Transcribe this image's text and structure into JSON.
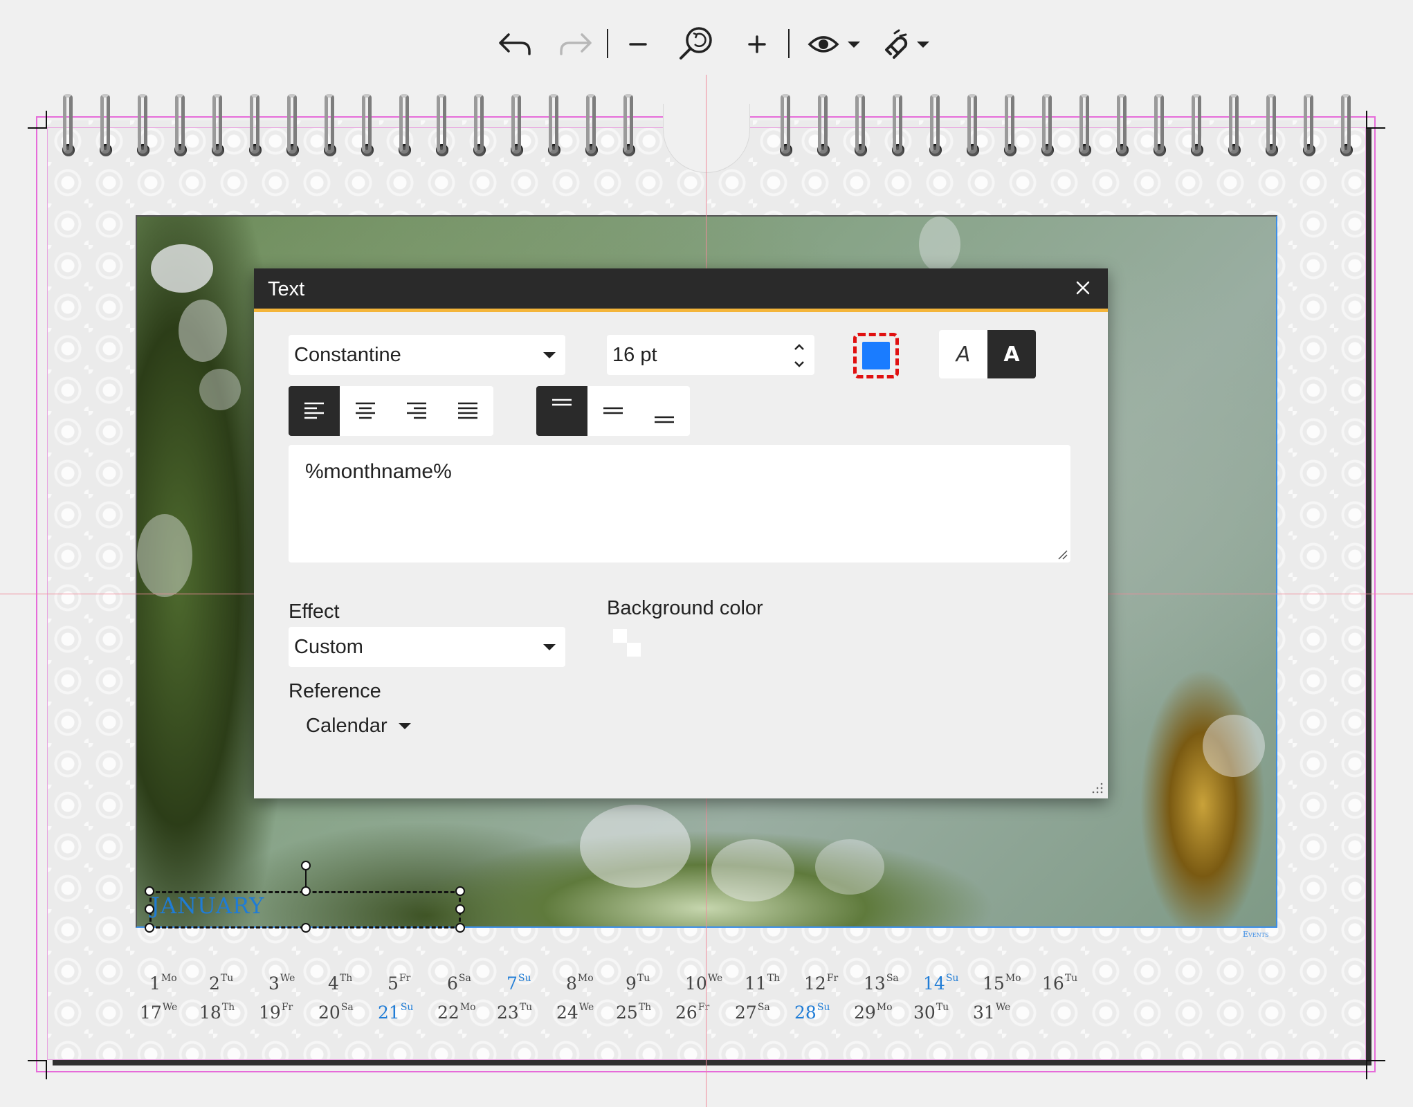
{
  "toolbar": {
    "undo": "undo-icon",
    "redo": "redo-icon",
    "zoom_out": "minus-icon",
    "zoom_fit": "zoom-icon",
    "zoom_in": "plus-icon",
    "preview": "eye-icon",
    "snap": "magnet-icon"
  },
  "calendar": {
    "month_label": "JANUARY",
    "events_label": "Events",
    "days": [
      {
        "n": "1",
        "d": "Mo",
        "sun": false
      },
      {
        "n": "2",
        "d": "Tu",
        "sun": false
      },
      {
        "n": "3",
        "d": "We",
        "sun": false
      },
      {
        "n": "4",
        "d": "Th",
        "sun": false
      },
      {
        "n": "5",
        "d": "Fr",
        "sun": false
      },
      {
        "n": "6",
        "d": "Sa",
        "sun": false
      },
      {
        "n": "7",
        "d": "Su",
        "sun": true
      },
      {
        "n": "8",
        "d": "Mo",
        "sun": false
      },
      {
        "n": "9",
        "d": "Tu",
        "sun": false
      },
      {
        "n": "10",
        "d": "We",
        "sun": false
      },
      {
        "n": "11",
        "d": "Th",
        "sun": false
      },
      {
        "n": "12",
        "d": "Fr",
        "sun": false
      },
      {
        "n": "13",
        "d": "Sa",
        "sun": false
      },
      {
        "n": "14",
        "d": "Su",
        "sun": true
      },
      {
        "n": "15",
        "d": "Mo",
        "sun": false
      },
      {
        "n": "16",
        "d": "Tu",
        "sun": false
      },
      {
        "n": "17",
        "d": "We",
        "sun": false
      },
      {
        "n": "18",
        "d": "Th",
        "sun": false
      },
      {
        "n": "19",
        "d": "Fr",
        "sun": false
      },
      {
        "n": "20",
        "d": "Sa",
        "sun": false
      },
      {
        "n": "21",
        "d": "Su",
        "sun": true
      },
      {
        "n": "22",
        "d": "Mo",
        "sun": false
      },
      {
        "n": "23",
        "d": "Tu",
        "sun": false
      },
      {
        "n": "24",
        "d": "We",
        "sun": false
      },
      {
        "n": "25",
        "d": "Th",
        "sun": false
      },
      {
        "n": "26",
        "d": "Fr",
        "sun": false
      },
      {
        "n": "27",
        "d": "Sa",
        "sun": false
      },
      {
        "n": "28",
        "d": "Su",
        "sun": true
      },
      {
        "n": "29",
        "d": "Mo",
        "sun": false
      },
      {
        "n": "30",
        "d": "Tu",
        "sun": false
      },
      {
        "n": "31",
        "d": "We",
        "sun": false
      }
    ]
  },
  "dialog": {
    "title": "Text",
    "font": "Constantine",
    "size": "16 pt",
    "text_color": "#1a7cff",
    "text": "%monthname%",
    "effect_label": "Effect",
    "effect_value": "Custom",
    "background_label": "Background color",
    "reference_label": "Reference",
    "reference_value": "Calendar",
    "style_regular": "A",
    "style_bold": "A"
  }
}
